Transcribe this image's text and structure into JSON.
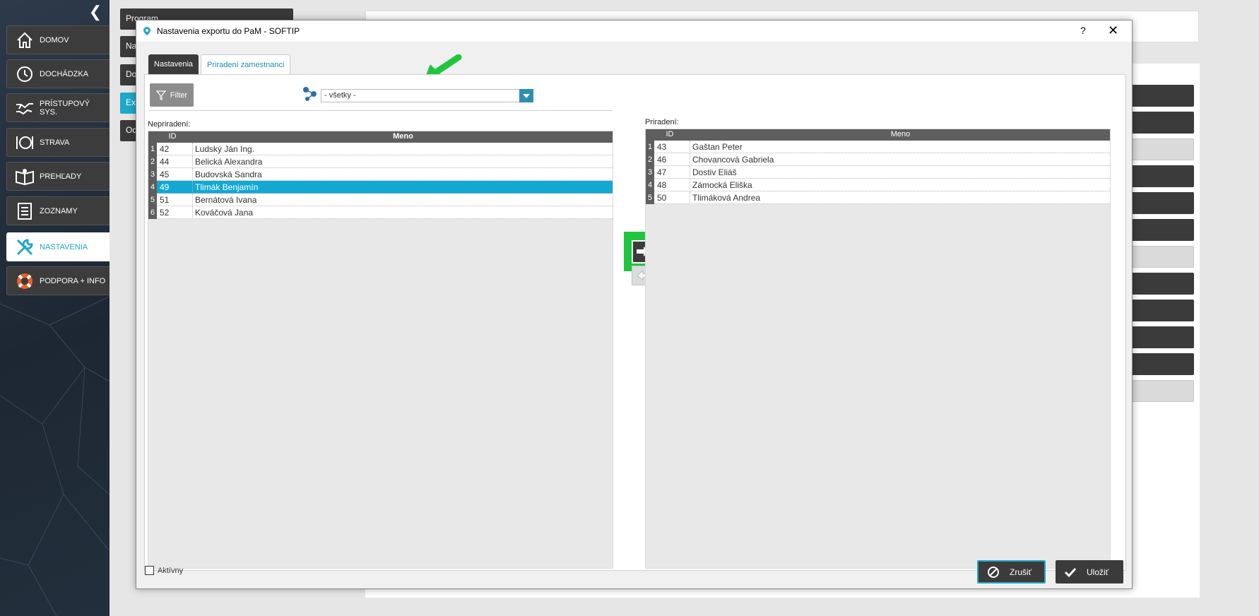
{
  "sidebar": {
    "items": [
      {
        "label": "DOMOV",
        "icon": "home-icon"
      },
      {
        "label": "DOCHÁDZKA",
        "icon": "clock-icon"
      },
      {
        "label": "PRÍSTUPOVÝ SYS.",
        "icon": "handshake-icon"
      },
      {
        "label": "STRAVA",
        "icon": "plate-icon"
      },
      {
        "label": "PREHĽADY",
        "icon": "reading-icon"
      },
      {
        "label": "ZOZNAMY",
        "icon": "list-icon"
      },
      {
        "label": "NASTAVENIA",
        "icon": "wrench-icon"
      },
      {
        "label": "PODPORA + INFO",
        "icon": "lifebuoy-icon"
      }
    ]
  },
  "background": {
    "buttons": [
      "Program",
      "Na",
      "Do",
      "Ex",
      "Od"
    ]
  },
  "dialog": {
    "title": "Nastavenia exportu do PaM - SOFTIP",
    "help": "?",
    "close": "✕",
    "tabs": [
      "Nastavenia",
      "Priradení zamestnanci"
    ],
    "filter_label": "Filter",
    "group_select": "- všetky -",
    "unassigned_label": "Nepriradení:",
    "assigned_label": "Priradení:",
    "columns": [
      "ID",
      "Meno"
    ],
    "unassigned": [
      {
        "n": "1",
        "id": "42",
        "name": "Ludský Ján Ing."
      },
      {
        "n": "2",
        "id": "44",
        "name": "Belická Alexandra"
      },
      {
        "n": "3",
        "id": "45",
        "name": "Budovská Sandra"
      },
      {
        "n": "4",
        "id": "49",
        "name": "Tlimák Benjamín"
      },
      {
        "n": "5",
        "id": "51",
        "name": "Bernátová Ivana"
      },
      {
        "n": "6",
        "id": "52",
        "name": "Kováčová Jana"
      }
    ],
    "selected_row_index": 3,
    "assigned": [
      {
        "n": "1",
        "id": "43",
        "name": "Gaštan Peter"
      },
      {
        "n": "2",
        "id": "46",
        "name": "Chovancová Gabriela"
      },
      {
        "n": "3",
        "id": "47",
        "name": "Dostiv Eliáš"
      },
      {
        "n": "4",
        "id": "48",
        "name": "Zámocká Eliška"
      },
      {
        "n": "5",
        "id": "50",
        "name": "Tlimáková Andrea"
      }
    ],
    "active_checkbox": "Aktívny",
    "cancel": "Zrušiť",
    "save": "Uložiť"
  },
  "colors": {
    "accent": "#1fa8c9",
    "highlight": "#1ec63e",
    "selected_row": "#12a8d1"
  }
}
